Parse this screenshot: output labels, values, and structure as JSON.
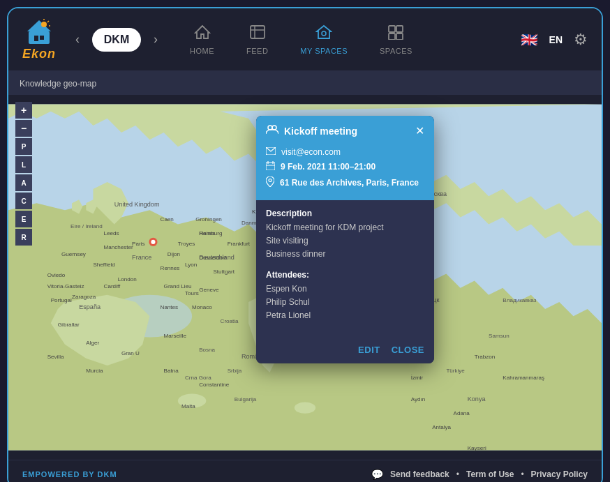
{
  "app": {
    "title": "Ekon",
    "border_color": "#3a9fd6"
  },
  "header": {
    "logo_text": "Ekon",
    "nav_badge": "DKM",
    "nav_prev": "‹",
    "nav_next": "›",
    "tabs": [
      {
        "id": "home",
        "label": "HOME",
        "active": false
      },
      {
        "id": "feed",
        "label": "FEED",
        "active": false
      },
      {
        "id": "my-spaces",
        "label": "MY SPACES",
        "active": true
      },
      {
        "id": "spaces",
        "label": "SPACES",
        "active": false
      }
    ],
    "language": "EN",
    "settings_icon": "⚙"
  },
  "breadcrumb": {
    "text": "Knowledge geo-map"
  },
  "map_controls": {
    "buttons": [
      "+",
      "−",
      "P",
      "L",
      "A",
      "C",
      "E",
      "R"
    ]
  },
  "popup": {
    "title": "Kickoff meeting",
    "close_label": "✕",
    "email": "visit@econ.com",
    "date": "9 Feb. 2021 11:00–21:00",
    "location": "61 Rue des Archives, Paris, France",
    "description_label": "Description",
    "description_lines": [
      "Kickoff meeting for KDM project",
      "Site visiting",
      "Business dinner"
    ],
    "attendees_label": "Attendees:",
    "attendees": [
      "Espen Kon",
      "Philip Schul",
      "Petra Lionel"
    ],
    "edit_label": "EDIT",
    "close_btn_label": "CLOSE"
  },
  "footer": {
    "empowered_by": "EMPOWERED BY DKM",
    "send_feedback": "Send feedback",
    "term_of_use": "Term of Use",
    "privacy_policy": "Privacy Policy"
  }
}
